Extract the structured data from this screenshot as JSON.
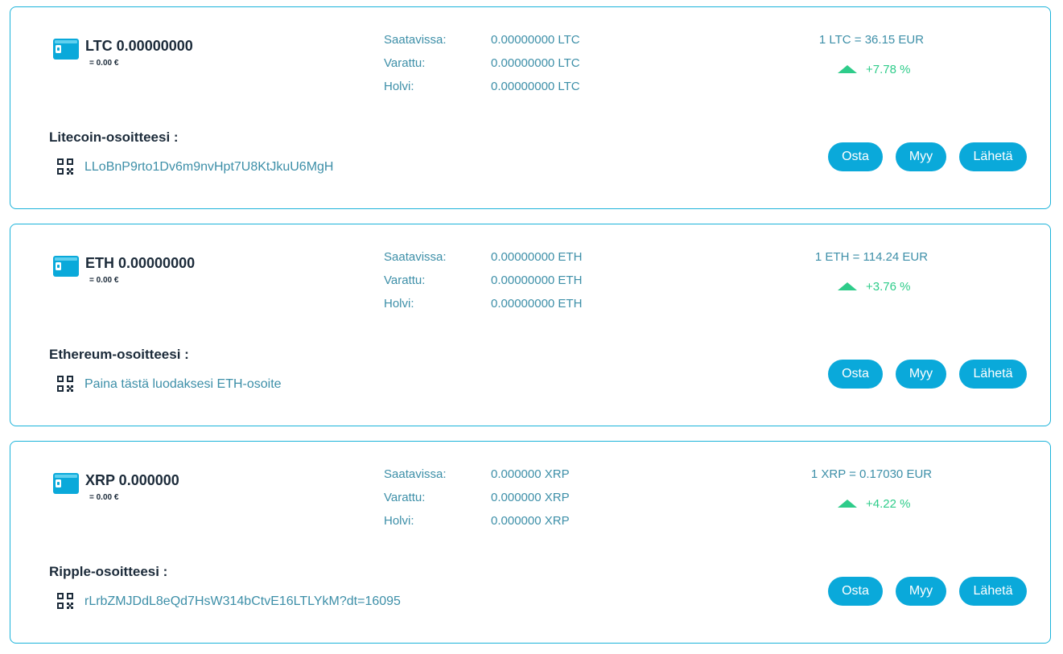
{
  "wallets": [
    {
      "title": "LTC 0.00000000",
      "fiat": "= 0.00 €",
      "available_label": "Saatavissa:",
      "available_value": "0.00000000 LTC",
      "reserved_label": "Varattu:",
      "reserved_value": "0.00000000 LTC",
      "vault_label": "Holvi:",
      "vault_value": "0.00000000 LTC",
      "rate": "1 LTC = 36.15 EUR",
      "change": "+7.78 %",
      "address_heading": "Litecoin-osoitteesi :",
      "address": "LLoBnP9rto1Dv6m9nvHpt7U8KtJkuU6MgH",
      "buy_label": "Osta",
      "sell_label": "Myy",
      "send_label": "Lähetä"
    },
    {
      "title": "ETH 0.00000000",
      "fiat": "= 0.00 €",
      "available_label": "Saatavissa:",
      "available_value": "0.00000000 ETH",
      "reserved_label": "Varattu:",
      "reserved_value": "0.00000000 ETH",
      "vault_label": "Holvi:",
      "vault_value": "0.00000000 ETH",
      "rate": "1 ETH = 114.24 EUR",
      "change": "+3.76 %",
      "address_heading": "Ethereum-osoitteesi :",
      "address": "Paina tästä luodaksesi ETH-osoite",
      "buy_label": "Osta",
      "sell_label": "Myy",
      "send_label": "Lähetä"
    },
    {
      "title": "XRP 0.000000",
      "fiat": "= 0.00 €",
      "available_label": "Saatavissa:",
      "available_value": "0.000000 XRP",
      "reserved_label": "Varattu:",
      "reserved_value": "0.000000 XRP",
      "vault_label": "Holvi:",
      "vault_value": "0.000000 XRP",
      "rate": "1 XRP = 0.17030 EUR",
      "change": "+4.22 %",
      "address_heading": "Ripple-osoitteesi :",
      "address": "rLrbZMJDdL8eQd7HsW314bCtvE16LTLYkM?dt=16095",
      "buy_label": "Osta",
      "sell_label": "Myy",
      "send_label": "Lähetä"
    }
  ],
  "icons": {
    "wallet": "wallet-icon",
    "qr": "qr-code-icon",
    "change": "arrow-up-icon"
  },
  "colors": {
    "accent": "#0aa9da",
    "border": "#1bb3da",
    "text_dark": "#1c2b3a",
    "text_teal": "#3d8fa8",
    "positive": "#2ecc8a"
  }
}
